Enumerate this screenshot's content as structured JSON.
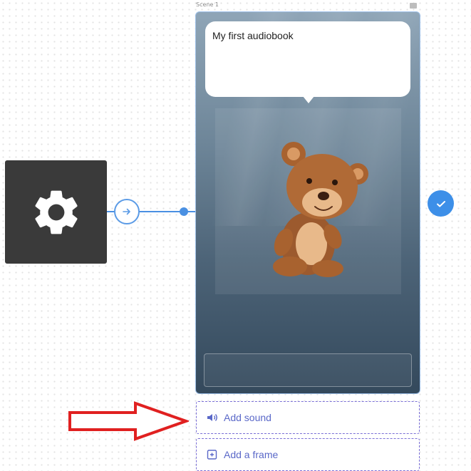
{
  "scene_card": {
    "bubble_text": "My first audiobook",
    "top_label": "Scene 1"
  },
  "actions": {
    "add_sound": "Add sound",
    "add_frame": "Add a frame"
  },
  "icons": {
    "settings": "gear-icon",
    "connector": "arrow-right-icon",
    "status": "checkmark-icon",
    "sound": "speaker-icon",
    "frame": "add-frame-icon",
    "illustration": "teddy-bear-illustration",
    "annotation": "red-arrow-annotation"
  },
  "colors": {
    "accent": "#4a90e2",
    "dashed_border": "#7a6fd6",
    "annotation_arrow": "#e02020",
    "settings_bg": "#3a3a3a"
  }
}
